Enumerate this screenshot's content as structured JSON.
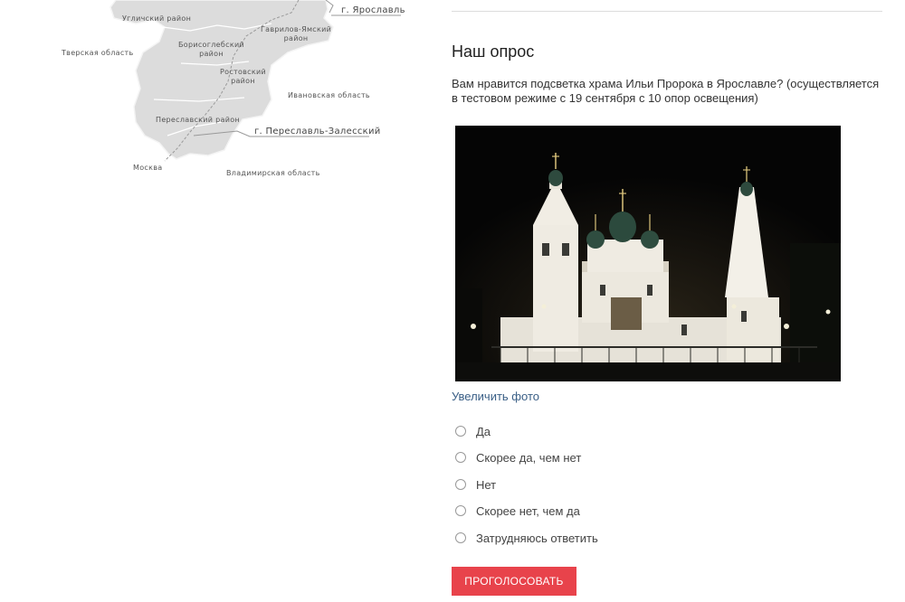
{
  "map": {
    "district_labels": [
      "Угличский район",
      "Гаврилов-Ямский\nрайон",
      "Борисоглебский\nрайон",
      "Ростовский\nрайон",
      "Переславский район"
    ],
    "neighbor_labels": [
      "Тверская область",
      "Ивановская область",
      "Владимирская область",
      "Москва"
    ],
    "city_labels": [
      "г. Ярославль",
      "г. Переславль-Залесский"
    ],
    "colors": {
      "region": "#dcdcdc",
      "border": "#ffffff",
      "road": "#9a9a9a"
    }
  },
  "poll": {
    "title": "Наш опрос",
    "question": "Вам нравится подсветка храма Ильи Пророка в Ярославле? (осуществляется в тестовом режиме с 19 сентября с 10 опор освещения)",
    "enlarge_link": "Увеличить фото",
    "options": [
      "Да",
      "Скорее да, чем нет",
      "Нет",
      "Скорее нет, чем да",
      "Затрудняюсь ответить"
    ],
    "vote_button": "ПРОГОЛОСОВАТЬ",
    "colors": {
      "button": "#e8434b",
      "link": "#3a5f86"
    }
  }
}
